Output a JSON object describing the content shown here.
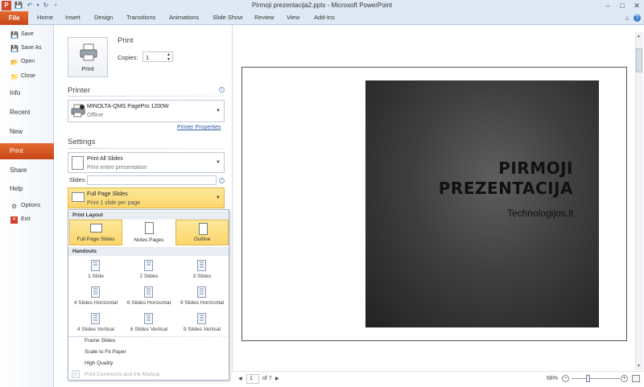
{
  "window": {
    "title": "Pirmoji prezentacija2.pptx  -  Microsoft PowerPoint",
    "minimize": "–",
    "maximize": "□",
    "close": "✕"
  },
  "ribbon": {
    "file_tab": "File",
    "tabs": [
      "Home",
      "Insert",
      "Design",
      "Transitions",
      "Animations",
      "Slide Show",
      "Review",
      "View",
      "Add-Ins"
    ]
  },
  "nav": {
    "small_items": [
      "Save",
      "Save As",
      "Open",
      "Close"
    ],
    "big_items": [
      "Info",
      "Recent",
      "New"
    ],
    "active": "Print",
    "big_items_after": [
      "Share",
      "Help"
    ],
    "bottom_items": [
      "Options",
      "Exit"
    ]
  },
  "print": {
    "header": "Print",
    "button_label": "Print",
    "copies_label": "Copies:",
    "copies_value": "1"
  },
  "printer": {
    "header": "Printer",
    "name": "MINOLTA-QMS PagePro 1200W",
    "status": "Offline",
    "properties_link": "Printer Properties"
  },
  "settings": {
    "header": "Settings",
    "range_main": "Print All Slides",
    "range_sub": "Print entire presentation",
    "slides_label": "Slides:",
    "slides_value": "",
    "layout_main": "Full Page Slides",
    "layout_sub": "Print 1 slide per page"
  },
  "popup": {
    "section_layout": "Print Layout",
    "layouts": [
      "Full Page Slides",
      "Notes Pages",
      "Outline"
    ],
    "section_handouts": "Handouts",
    "handouts": [
      "1 Slide",
      "2 Slides",
      "3 Slides",
      "4 Slides Horizontal",
      "6 Slides Horizontal",
      "9 Slides Horizontal",
      "4 Slides Vertical",
      "6 Slides Vertical",
      "9 Slides Vertical"
    ],
    "options": [
      "Frame Slides",
      "Scale to Fit Paper",
      "High Quality",
      "Print Comments and Ink Markup"
    ]
  },
  "preview": {
    "slide_title_line1": "PIRMOJI",
    "slide_title_line2": "PREZENTACIJA",
    "slide_subtitle": "Technologijos.lt"
  },
  "pager": {
    "current_page": "1",
    "total": "of 7",
    "zoom": "68%"
  }
}
